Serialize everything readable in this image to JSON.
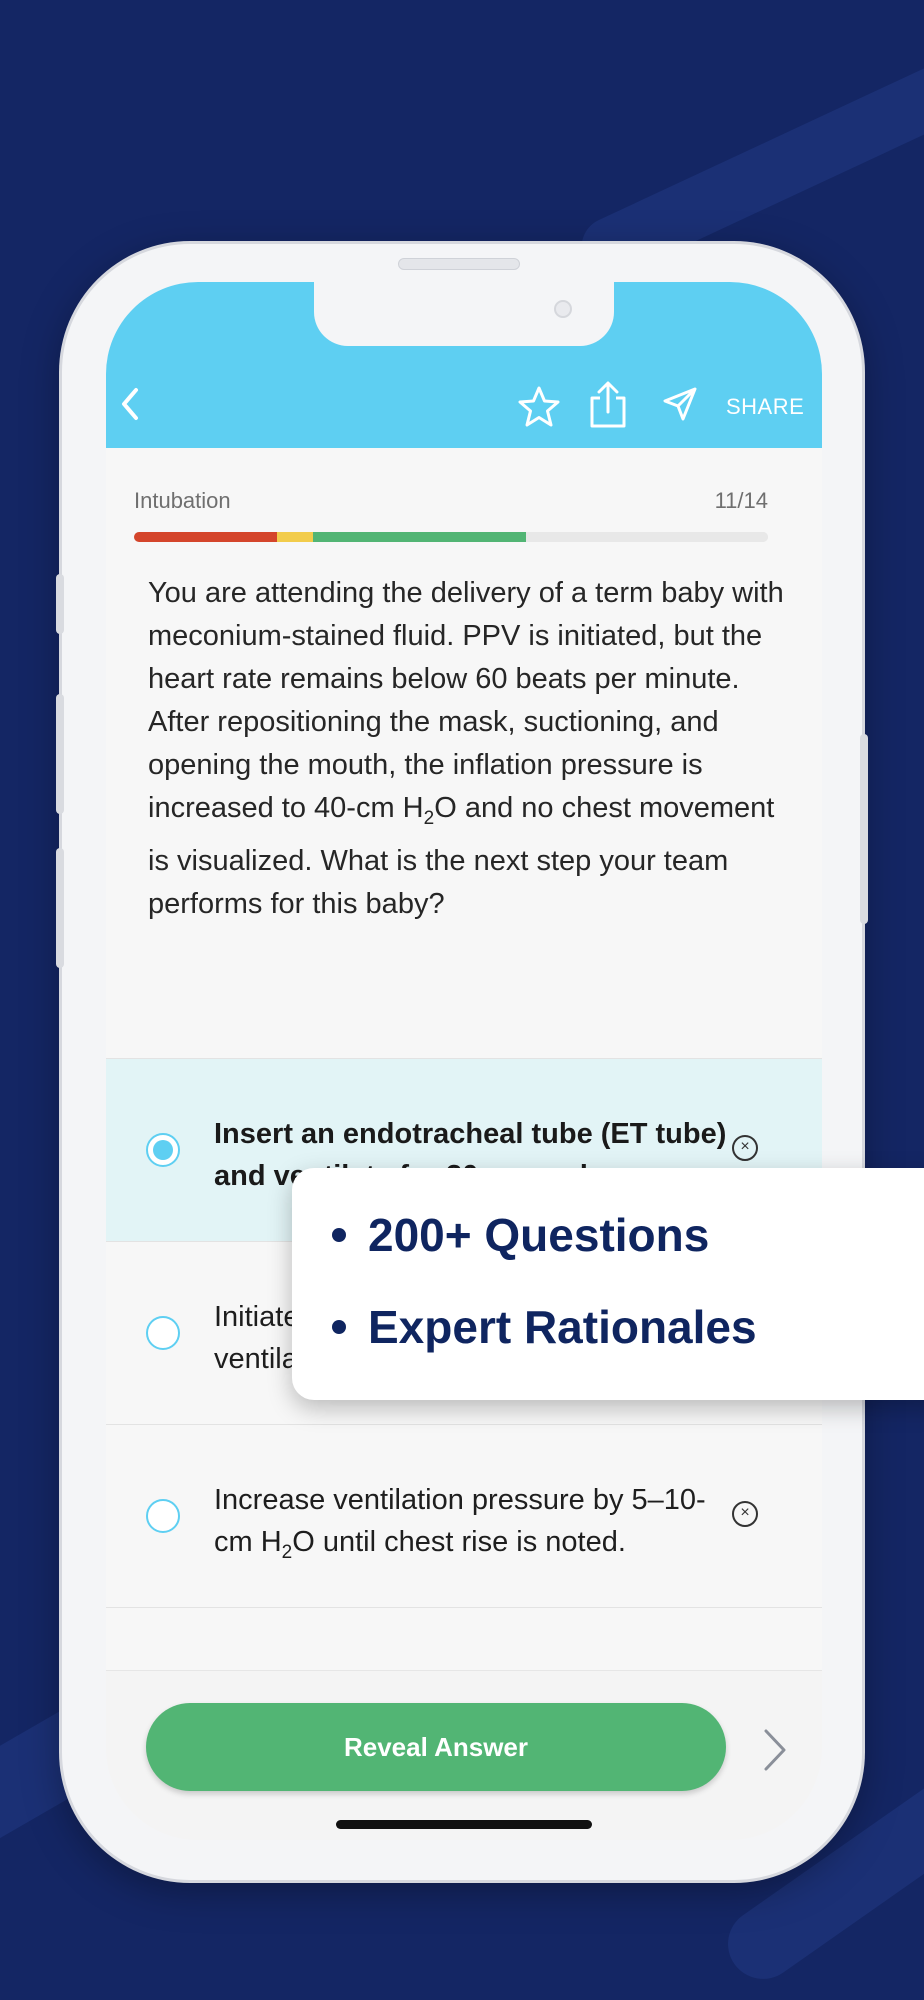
{
  "header": {
    "share_label": "SHARE",
    "icons": [
      "back-chevron-icon",
      "star-icon",
      "export-icon",
      "send-icon"
    ],
    "color": "#5ecff2"
  },
  "quiz": {
    "topic": "Intubation",
    "counter": "11/14",
    "progress_segments": [
      {
        "color": "#d4452b",
        "fraction": 0.225
      },
      {
        "color": "#f2cc4b",
        "fraction": 0.057
      },
      {
        "color": "#52b574",
        "fraction": 0.336
      },
      {
        "color": "#e8e8e8",
        "fraction": 0.382
      }
    ],
    "question": {
      "part1": "You are attending the delivery of a term baby with meconium-stained fluid. PPV is initiated, but the heart rate remains below 60 beats per minute. After repositioning the mask, suctioning, and opening the mouth, the inflation pressure is increased to 40-cm H",
      "sub": "2",
      "part2": "O and no chest movement is visualized. What is the next step your team performs for this baby?"
    }
  },
  "options": [
    {
      "text": "Insert an endotracheal tube (ET tube) and ventilate for 30 seconds.",
      "selected": true
    },
    {
      "text": "Initiate coordinated compressions and ventilations.",
      "selected": false
    },
    {
      "text_part1": "Increase ventilation pressure by 5–10-cm H",
      "sub": "2",
      "text_part2": "O until chest rise is noted.",
      "selected": false
    }
  ],
  "dismiss_glyph": "×",
  "actions": {
    "reveal_label": "Reveal Answer",
    "reveal_color": "#52b574"
  },
  "callout": {
    "items": [
      "200+ Questions",
      "Expert Rationales"
    ],
    "text_color": "#0f2560"
  }
}
